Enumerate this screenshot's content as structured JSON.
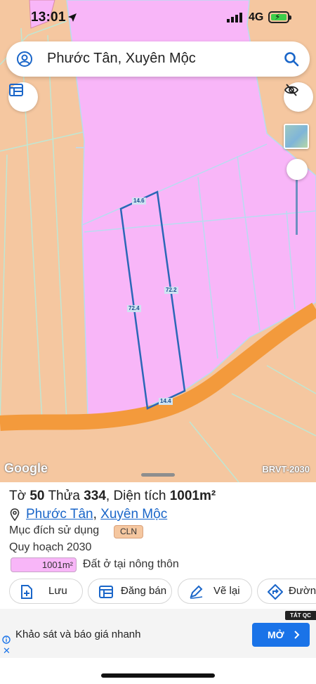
{
  "status_bar": {
    "time": "13:01",
    "network": "4G"
  },
  "search": {
    "text": "Phước Tân, Xuyên Mộc"
  },
  "map": {
    "google_logo": "Google",
    "layer_name": "BRVT-2030",
    "parcel_edge_labels": {
      "top": "14.6",
      "left": "72.4",
      "right": "72.2",
      "bottom": "14.4"
    },
    "colors": {
      "agricultural_land": "#f5c7a0",
      "residential_land": "#f8b6f8",
      "road": "#f39a3c",
      "parcel_outline": "#2b67b7"
    }
  },
  "parcel": {
    "title_prefix": "Tờ",
    "sheet_number": "50",
    "lot_prefix": "Thửa",
    "lot_number": "334",
    "area_prefix": ", Diện tích",
    "area": "1001m²",
    "ward": "Phước Tân",
    "separator": ",",
    "district": "Xuyên Mộc",
    "purpose_label": "Mục đích sử dụng",
    "purpose_code": "CLN",
    "plan_label": "Quy hoạch 2030",
    "plan_area": "1001m²",
    "plan_land_use": "Đất ở tại nông thôn"
  },
  "actions": [
    {
      "label": "Lưu",
      "icon": "save-plus-icon"
    },
    {
      "label": "Đăng bán",
      "icon": "post-listing-icon"
    },
    {
      "label": "Vẽ lại",
      "icon": "redraw-icon"
    },
    {
      "label": "Đường",
      "icon": "directions-icon"
    }
  ],
  "ad": {
    "tag": "TÁT QC",
    "text": "Khảo sát và báo giá nhanh",
    "button": "MỞ"
  }
}
